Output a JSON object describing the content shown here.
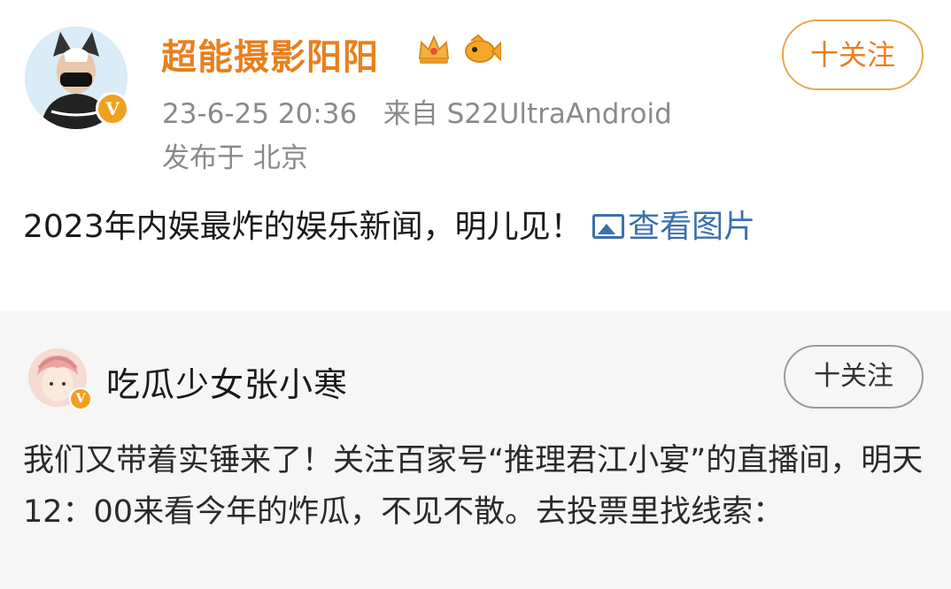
{
  "post": {
    "author": "超能摄影阳阳",
    "verified_badge": "V",
    "time": "23-6-25 20:36",
    "source_prefix": "来自",
    "source": "S22UltraAndroid",
    "location": "发布于 北京",
    "follow_label": "十关注",
    "content": "2023年内娱最炸的娱乐新闻，明儿见！",
    "view_image_label": "查看图片",
    "icons": [
      "crown-icon",
      "fish-icon",
      "picture-icon"
    ]
  },
  "repost": {
    "author": "吃瓜少女张小寒",
    "verified_badge": "V",
    "follow_label": "十关注",
    "content": "我们又带着实锤来了！关注百家号“推理君江小宴”的直播间，明天12：00来看今年的炸瓜，不见不散。去投票里找线索："
  },
  "colors": {
    "author_orange": "#e8801d",
    "link_blue": "#3c6fad",
    "meta_gray": "#8a8a8a",
    "repost_bg": "#f6f6f6"
  }
}
